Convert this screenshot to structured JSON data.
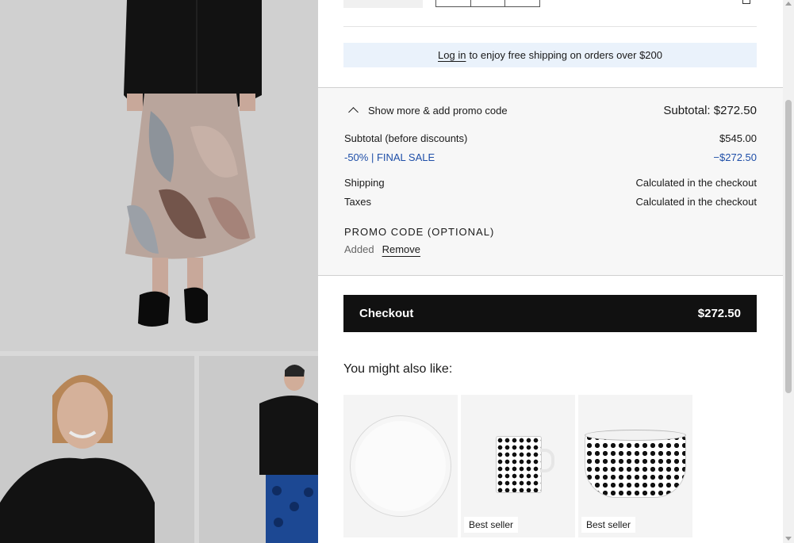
{
  "cart": {
    "login_banner": {
      "link_text": "Log in",
      "text": "to enjoy free shipping on orders over $200"
    },
    "summary": {
      "toggle_label": "Show more & add promo code",
      "subtotal_head": "Subtotal: $272.50",
      "rows": [
        {
          "label": "Subtotal (before discounts)",
          "value": "$545.00"
        },
        {
          "label": "-50% | FINAL SALE",
          "value": "−$272.50"
        },
        {
          "label": "Shipping",
          "value": "Calculated in the checkout"
        },
        {
          "label": "Taxes",
          "value": "Calculated in the checkout"
        }
      ],
      "promo_label": "PROMO CODE (OPTIONAL)",
      "promo_added": "Added",
      "promo_remove": "Remove"
    },
    "checkout": {
      "label": "Checkout",
      "amount": "$272.50"
    },
    "suggestions": {
      "title": "You might also like:",
      "items": [
        {
          "icon": "plate-image",
          "badge": ""
        },
        {
          "icon": "mug-image",
          "badge": "Best seller"
        },
        {
          "icon": "bowl-image",
          "badge": "Best seller"
        }
      ]
    }
  },
  "colors": {
    "banner_bg": "#eaf2fb",
    "discount": "#1f4fa8",
    "checkout_bg": "#111111"
  }
}
